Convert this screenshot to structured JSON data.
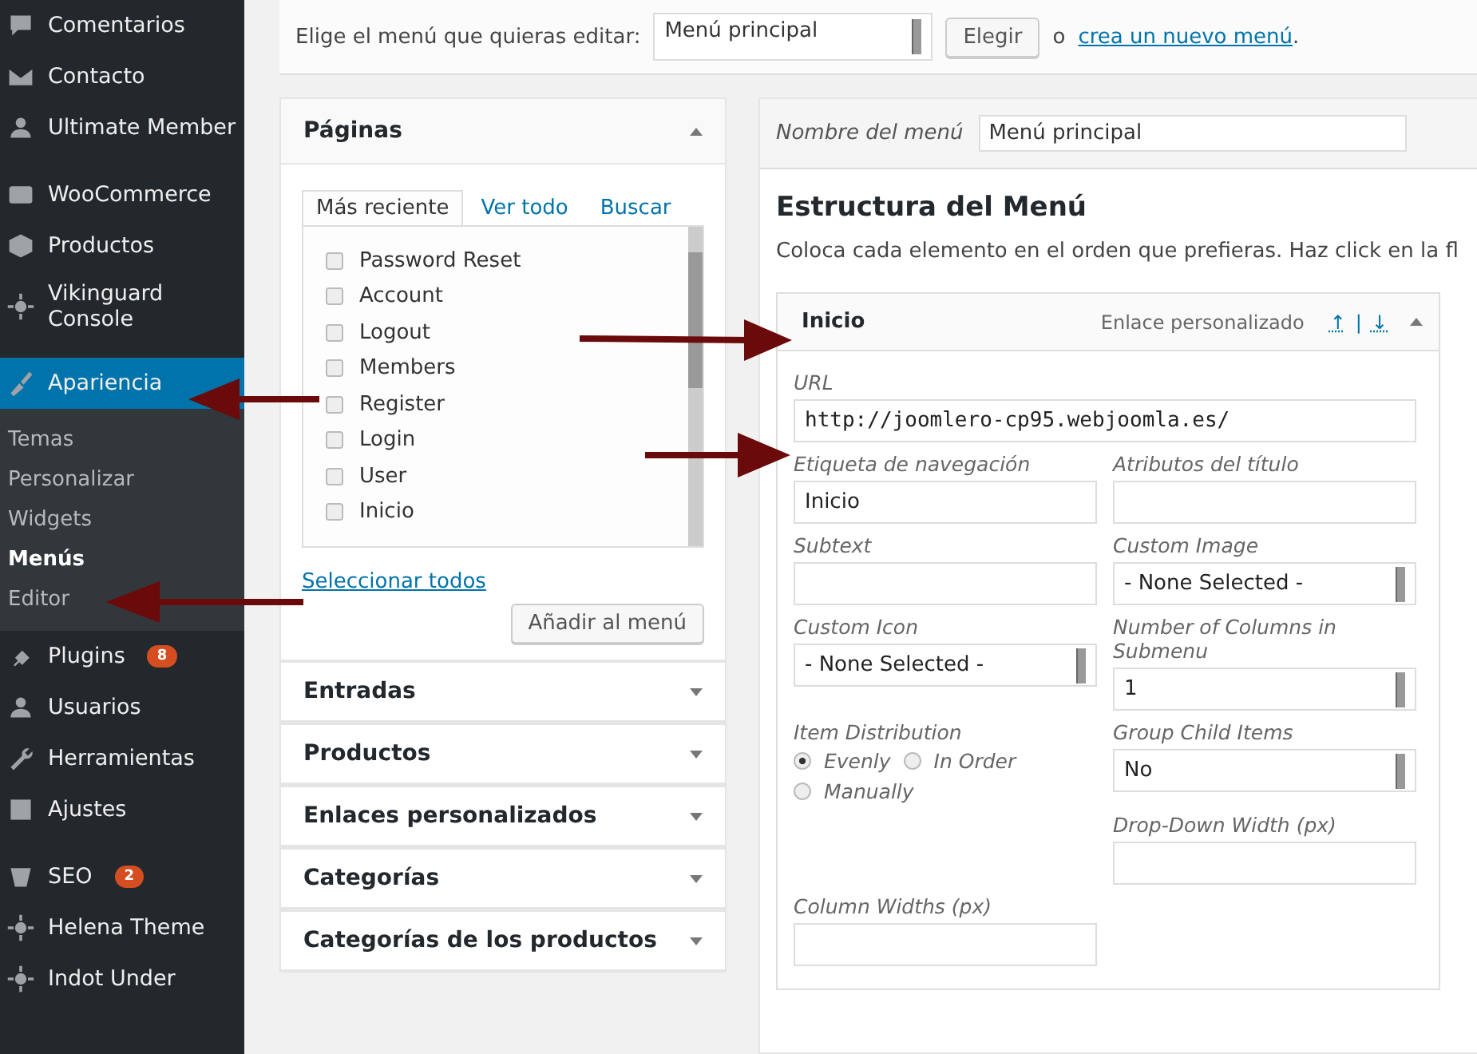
{
  "sidebar": {
    "items": [
      {
        "label": "Comentarios",
        "selected": false
      },
      {
        "label": "Contacto",
        "selected": false
      },
      {
        "label": "Ultimate Member",
        "selected": false
      },
      {
        "label": "WooCommerce",
        "selected": false
      },
      {
        "label": "Productos",
        "selected": false
      },
      {
        "label": "Vikinguard Console",
        "selected": false
      },
      {
        "label": "Apariencia",
        "selected": true,
        "children": [
          {
            "label": "Temas",
            "selected": false
          },
          {
            "label": "Personalizar",
            "selected": false
          },
          {
            "label": "Widgets",
            "selected": false
          },
          {
            "label": "Menús",
            "selected": true
          },
          {
            "label": "Editor",
            "selected": false
          }
        ]
      },
      {
        "label": "Plugins",
        "selected": false,
        "badge": "8"
      },
      {
        "label": "Usuarios",
        "selected": false
      },
      {
        "label": "Herramientas",
        "selected": false
      },
      {
        "label": "Ajustes",
        "selected": false
      },
      {
        "label": "SEO",
        "selected": false,
        "badge": "2"
      },
      {
        "label": "Helena Theme",
        "selected": false
      },
      {
        "label": "Indot Under",
        "selected": false
      }
    ]
  },
  "menu_select": {
    "label": "Elige el menú que quieras editar:",
    "value": "Menú principal",
    "button": "Elegir",
    "or": "o",
    "create_link": "crea un nuevo menú",
    "after": "."
  },
  "add_items": {
    "sections": [
      {
        "title": "Páginas",
        "expanded": true,
        "tabs": [
          {
            "label": "Más reciente",
            "selected": true
          },
          {
            "label": "Ver todo",
            "selected": false
          },
          {
            "label": "Buscar",
            "selected": false
          }
        ],
        "items": [
          {
            "label": "Password Reset",
            "checked": false
          },
          {
            "label": "Account",
            "checked": false
          },
          {
            "label": "Logout",
            "checked": false
          },
          {
            "label": "Members",
            "checked": false
          },
          {
            "label": "Register",
            "checked": false
          },
          {
            "label": "Login",
            "checked": false
          },
          {
            "label": "User",
            "checked": false
          },
          {
            "label": "Inicio",
            "checked": false
          }
        ],
        "select_all": "Seleccionar todos",
        "add_button": "Añadir al menú"
      },
      {
        "title": "Entradas",
        "expanded": false
      },
      {
        "title": "Productos",
        "expanded": false
      },
      {
        "title": "Enlaces personalizados",
        "expanded": false
      },
      {
        "title": "Categorías",
        "expanded": false
      },
      {
        "title": "Categorías de los productos",
        "expanded": false
      }
    ]
  },
  "menu_editor": {
    "name_label": "Nombre del menú",
    "name_value": "Menú principal",
    "heading": "Estructura del Menú",
    "description": "Coloca cada elemento en el orden que prefieras. Haz click en la fl",
    "item": {
      "title": "Inicio",
      "type": "Enlace personalizado",
      "up": "↑",
      "sep": "|",
      "down": "↓",
      "expanded": true,
      "fields": [
        {
          "kind": "text",
          "label": "URL",
          "value": "http://joomlero-cp95.webjoomla.es/"
        },
        {
          "kind": "text",
          "label": "Etiqueta de navegación",
          "value": "Inicio"
        },
        {
          "kind": "text",
          "label": "Atributos del título"
        },
        {
          "kind": "text",
          "label": "Subtext"
        },
        {
          "kind": "select",
          "label": "Custom Image",
          "value": "- None Selected -"
        },
        {
          "kind": "select",
          "label": "Custom Icon",
          "value": "- None Selected -"
        },
        {
          "kind": "select",
          "label": "Number of Columns in Submenu",
          "value": "1"
        },
        {
          "kind": "radio",
          "label": "Item Distribution",
          "options": [
            {
              "label": "Evenly",
              "selected": true
            },
            {
              "label": "In Order",
              "selected": false
            },
            {
              "label": "Manually",
              "selected": false
            }
          ]
        },
        {
          "kind": "select",
          "label": "Group Child Items",
          "value": "No"
        },
        {
          "kind": "spacer"
        },
        {
          "kind": "text",
          "label": "Drop-Down Width (px)"
        },
        {
          "kind": "text",
          "label": "Column Widths (px)"
        }
      ]
    }
  }
}
